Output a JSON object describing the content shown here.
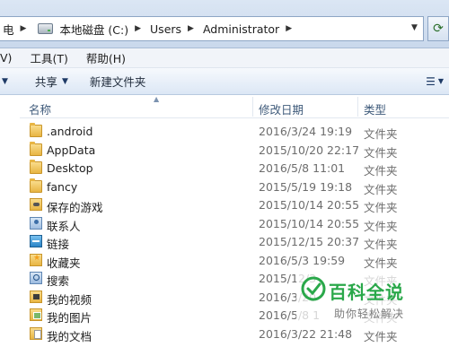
{
  "address_bar": {
    "first_crumb_fragment": "电",
    "crumbs": [
      "本地磁盘 (C:)",
      "Users",
      "Administrator"
    ]
  },
  "menu": {
    "view": "V)",
    "tools": "工具(T)",
    "help": "帮助(H)"
  },
  "commands": {
    "share": "共享",
    "new_folder": "新建文件夹"
  },
  "columns": {
    "name": "名称",
    "modified": "修改日期",
    "type": "类型"
  },
  "files": [
    {
      "name": ".android",
      "date": "2016/3/24 19:19",
      "type": "文件夹",
      "icon": "folder-icon"
    },
    {
      "name": "AppData",
      "date": "2015/10/20 22:17",
      "type": "文件夹",
      "icon": "folder-icon"
    },
    {
      "name": "Desktop",
      "date": "2016/5/8 11:01",
      "type": "文件夹",
      "icon": "folder-icon"
    },
    {
      "name": "fancy",
      "date": "2015/5/19 19:18",
      "type": "文件夹",
      "icon": "folder-icon"
    },
    {
      "name": "保存的游戏",
      "date": "2015/10/14 20:55",
      "type": "文件夹",
      "icon": "saved-games-icon"
    },
    {
      "name": "联系人",
      "date": "2015/10/14 20:55",
      "type": "文件夹",
      "icon": "contacts-icon"
    },
    {
      "name": "链接",
      "date": "2015/12/15 20:37",
      "type": "文件夹",
      "icon": "links-icon"
    },
    {
      "name": "收藏夹",
      "date": "2016/5/3 19:59",
      "type": "文件夹",
      "icon": "favorites-icon"
    },
    {
      "name": "搜索",
      "date": "2015/12/3",
      "type": "文件夹",
      "icon": "searches-icon"
    },
    {
      "name": "我的视频",
      "date": "2016/3/20",
      "type": "文件夹",
      "icon": "videos-icon"
    },
    {
      "name": "我的图片",
      "date": "2016/5/8 1",
      "type": "文件夹",
      "icon": "pictures-icon"
    },
    {
      "name": "我的文档",
      "date": "2016/3/22 21:48",
      "type": "文件夹",
      "icon": "documents-icon"
    }
  ],
  "watermark": {
    "title": "百科全说",
    "subtitle": "助你轻松解决",
    "title_color": "#2aa84a"
  }
}
